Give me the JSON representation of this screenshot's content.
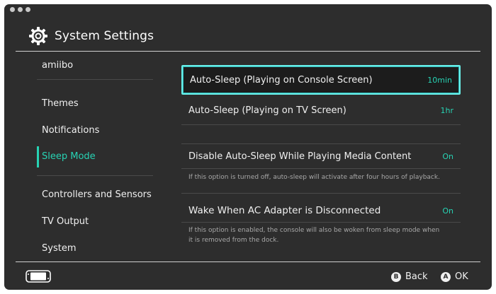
{
  "header": {
    "title": "System Settings",
    "icon": "gear-icon"
  },
  "sidebar": {
    "items": [
      {
        "label": "amiibo"
      },
      {
        "label": "Themes"
      },
      {
        "label": "Notifications"
      },
      {
        "label": "Sleep Mode",
        "active": true
      },
      {
        "label": "Controllers and Sensors"
      },
      {
        "label": "TV Output"
      },
      {
        "label": "System"
      }
    ]
  },
  "content": {
    "rows": [
      {
        "label": "Auto-Sleep (Playing on Console Screen)",
        "value": "10min",
        "selected": true
      },
      {
        "label": "Auto-Sleep (Playing on TV Screen)",
        "value": "1hr"
      },
      {
        "label": "Disable Auto-Sleep While Playing Media Content",
        "value": "On",
        "note": "If this option is turned off, auto-sleep will activate after four hours of playback."
      },
      {
        "label": "Wake When AC Adapter is Disconnected",
        "value": "On",
        "note_line1": "If this option is enabled, the console will also be woken from sleep mode when",
        "note_line2": "it is removed from the dock."
      }
    ]
  },
  "footer": {
    "back_button": "B",
    "back_label": "Back",
    "ok_button": "A",
    "ok_label": "OK"
  },
  "colors": {
    "accent": "#27d3b4",
    "selection": "#69f0ea",
    "background": "#2d2d2d"
  }
}
